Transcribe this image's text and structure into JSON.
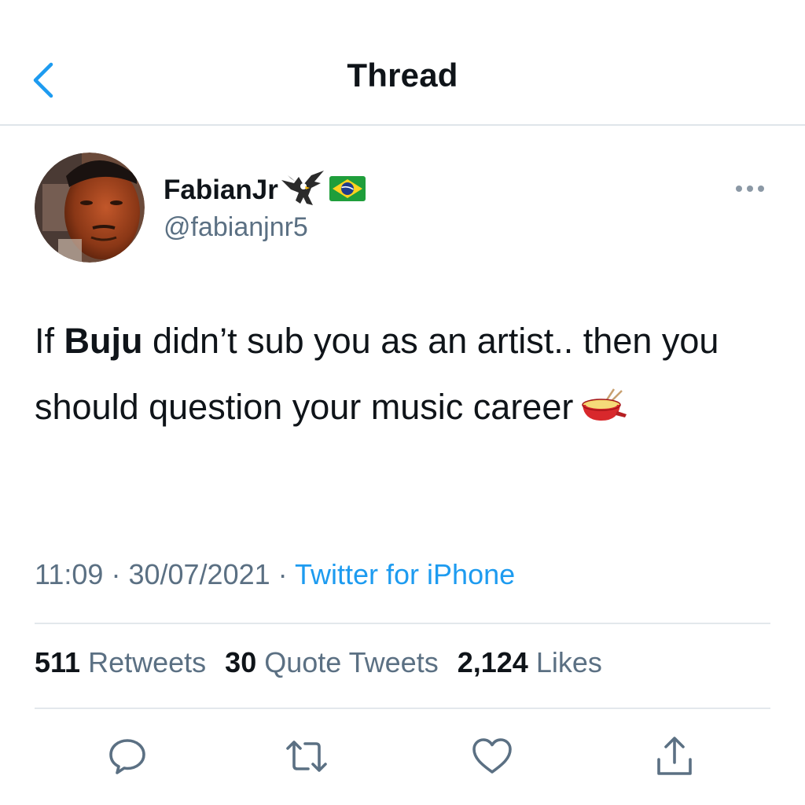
{
  "nav": {
    "title": "Thread"
  },
  "tweet": {
    "display_name": "FabianJr",
    "name_emojis": [
      "eagle-emoji",
      "brazil-flag-emoji"
    ],
    "handle": "@fabianjnr5",
    "text": {
      "part1": "If ",
      "bold": "Buju",
      "part2": " didn’t sub you as an artist.. then you should question your music career",
      "emoji": "fondue-emoji"
    },
    "time": "11:09",
    "separator": "·",
    "date": "30/07/2021",
    "source": "Twitter for iPhone"
  },
  "stats": {
    "retweets_count": "511",
    "retweets_label": "Retweets",
    "quotes_count": "30",
    "quotes_label": "Quote Tweets",
    "likes_count": "2,124",
    "likes_label": "Likes"
  },
  "icons": {
    "back": "chevron-left-icon",
    "more": "more-horizontal-icon",
    "reply": "reply-icon",
    "retweet": "retweet-icon",
    "like": "heart-icon",
    "share": "share-icon"
  },
  "colors": {
    "accent": "#1d9bf0",
    "secondary_text": "#5b7083",
    "primary_text": "#0f1419",
    "divider": "#e3e8ec",
    "icon_gray": "#5b7083"
  }
}
